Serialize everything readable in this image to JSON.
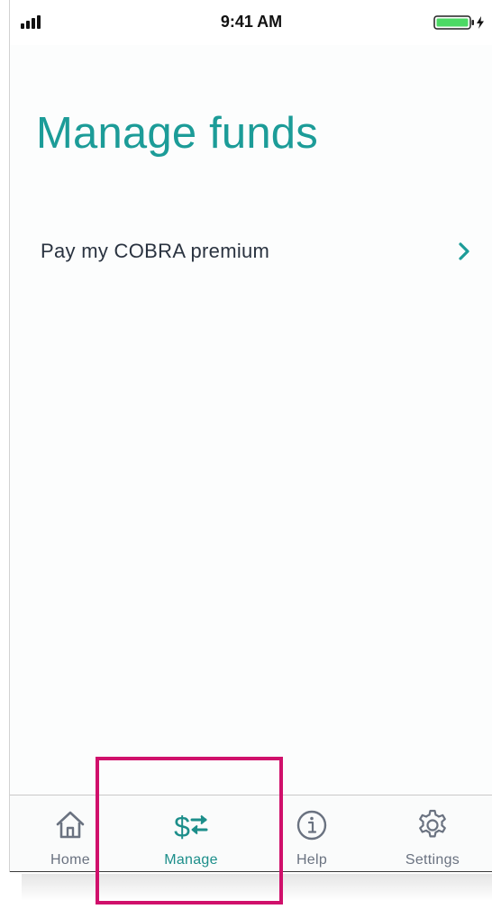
{
  "status_bar": {
    "time": "9:41 AM"
  },
  "page": {
    "title": "Manage funds"
  },
  "list": {
    "items": [
      {
        "label": "Pay my COBRA premium"
      }
    ]
  },
  "tab_bar": {
    "tabs": [
      {
        "label": "Home",
        "icon": "home-icon",
        "active": false
      },
      {
        "label": "Manage",
        "icon": "dollar-transfer-icon",
        "active": true
      },
      {
        "label": "Help",
        "icon": "info-icon",
        "active": false
      },
      {
        "label": "Settings",
        "icon": "gear-icon",
        "active": false
      }
    ]
  },
  "colors": {
    "accent": "#1c9c98",
    "text": "#2a3340",
    "inactive": "#6a7280",
    "highlight": "#d0106b",
    "battery": "#4cd964"
  }
}
